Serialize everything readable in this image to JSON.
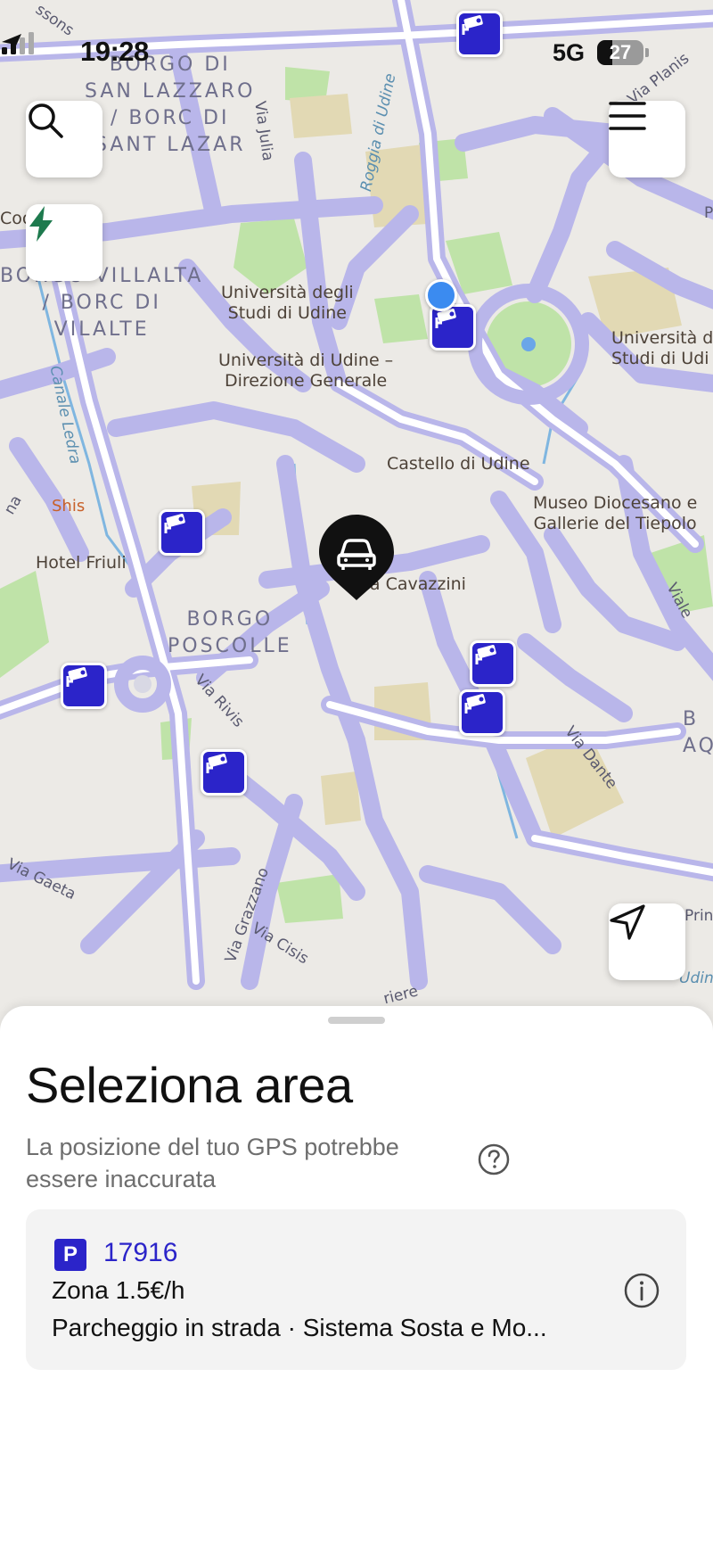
{
  "status": {
    "time": "19:28",
    "network": "5G",
    "battery": "27"
  },
  "map": {
    "labels": {
      "borgo_san_lazzaro": "BORGO DI\nSAN LAZZARO\n/ BORC DI\nSANT LAZAR",
      "borgo_villalta": "BORGO VILLALTA\n/ BORC DI\nVILALTE",
      "borgo_poscolle": "BORGO\nPOSCOLLE",
      "univ_studi": "Università degli\nStudi di Udine",
      "univ_direzione": "Università di Udine –\nDirezione Generale",
      "univ_right": "Università d\nStudi di Udi",
      "castello": "Castello di Udine",
      "museo": "Museo Diocesano e\nGallerie del Tiepolo",
      "casa_cavazzini": "sa Cavazzini",
      "shis": "Shis",
      "hotel_friuli": "Hotel Friuli",
      "via_julia": "Via Julia",
      "roggia": "Roggia di Udine",
      "canale_ledra": "Canale Ledra",
      "via_planis": "Via Planis",
      "via_rivis": "Via Rivis",
      "via_dante": "Via Dante",
      "via_gaeta": "Via Gaeta",
      "via_grazzano": "Via Grazzano",
      "via_cisis": "Via Cisis",
      "viale": "Viale",
      "cod": "Coo",
      "na": "na",
      "ssons": "ssons",
      "b_aq": "B\nAQ",
      "prin": "Prin",
      "udin": "Udin",
      "riere": "riere",
      "p_right": "P"
    }
  },
  "sheet": {
    "title": "Seleziona area",
    "subtitle": "La posizione del tuo GPS potrebbe essere inaccurata",
    "zone": {
      "badge": "P",
      "id": "17916",
      "name": "Zona 1.5€/h",
      "description": "Parcheggio in strada · Sistema Sosta e Mo..."
    }
  }
}
